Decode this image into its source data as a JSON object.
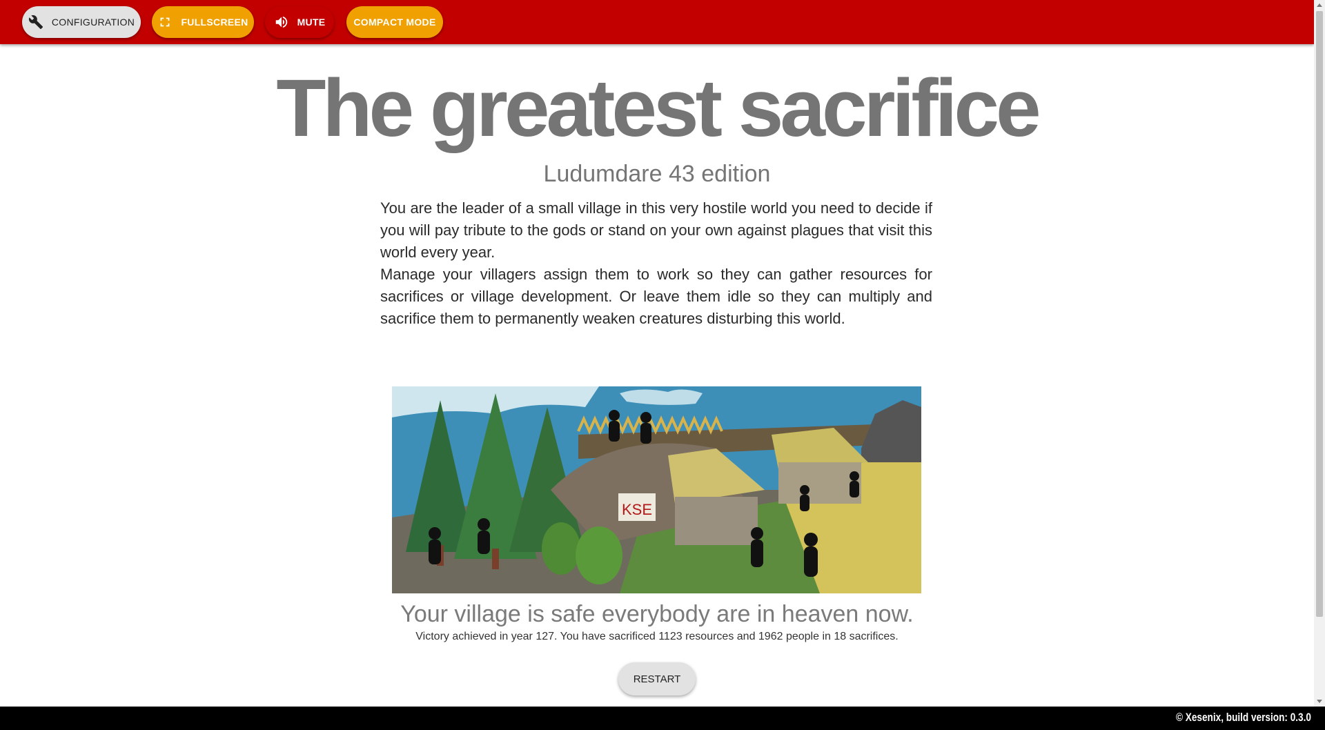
{
  "toolbar": {
    "configuration_label": "CONFIGURATION",
    "fullscreen_label": "FULLSCREEN",
    "mute_label": "MUTE",
    "compact_mode_label": "COMPACT MODE"
  },
  "icons": {
    "configuration": "wrench-icon",
    "fullscreen": "fullscreen-icon",
    "mute": "speaker-icon"
  },
  "colors": {
    "topbar": "#c20000",
    "accent_button": "#f0a000",
    "neutral_button": "#e2e2e2",
    "title_text": "#757575",
    "footer": "#000000"
  },
  "header": {
    "title": "The greatest sacrifice",
    "subtitle": "Ludumdare 43 edition"
  },
  "description": {
    "paragraph_1": "You are the leader of a small village in this very hostile world you need to decide if you will pay tribute to the gods or stand on your own against plagues that visit this world every year.",
    "paragraph_2": "Manage your villagers assign them to work so they can gather resources for sacrifices or village development. Or leave them idle so they can multiply and sacrifice them to permanently weaken creatures disturbing this world."
  },
  "scene": {
    "sign_text": "KSE"
  },
  "result": {
    "title": "Your village is safe everybody are in heaven now.",
    "stats": "Victory achieved in year 127. You have sacrificed 1123 resources and 1962 people in 18 sacrifices."
  },
  "actions": {
    "restart_label": "RESTART"
  },
  "footer": {
    "text": "© Xesenix, build version: 0.3.0"
  }
}
